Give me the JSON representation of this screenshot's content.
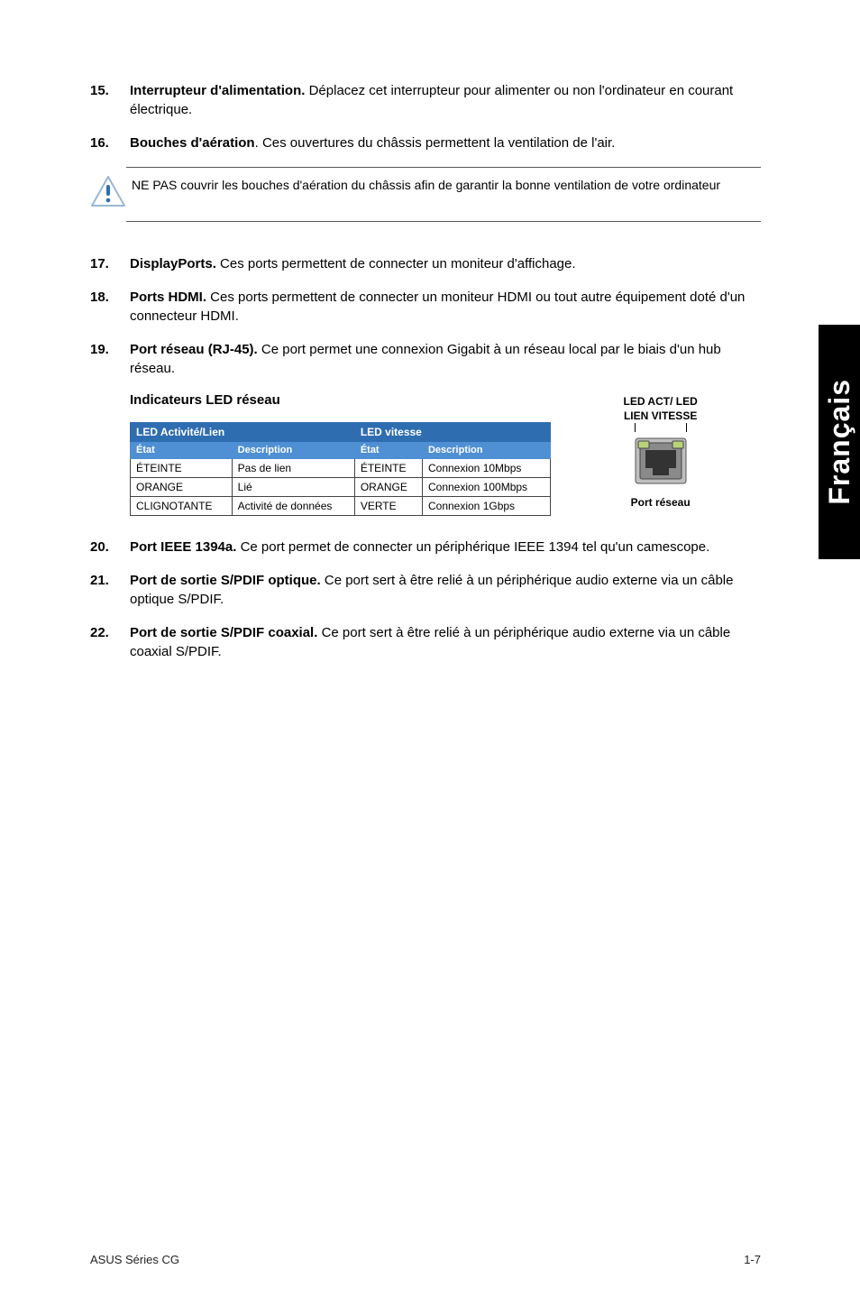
{
  "items": {
    "15": {
      "num": "15.",
      "title": "Interrupteur d'alimentation.",
      "text": " Déplacez cet interrupteur pour alimenter ou non l'ordinateur en courant électrique."
    },
    "16": {
      "num": "16.",
      "title": "Bouches d'aération",
      "text": ". Ces ouvertures du châssis permettent la ventilation de l'air."
    },
    "17": {
      "num": "17.",
      "title": "DisplayPorts.",
      "text": " Ces ports permettent de connecter un moniteur d'affichage."
    },
    "18": {
      "num": "18.",
      "title": "Ports HDMI.",
      "text": " Ces ports permettent de connecter un moniteur HDMI ou tout autre équipement doté d'un connecteur HDMI."
    },
    "19": {
      "num": "19.",
      "title": "Port réseau (RJ-45).",
      "text": " Ce port permet une connexion Gigabit à un réseau local par le biais d'un hub réseau."
    },
    "20": {
      "num": "20.",
      "title": "Port IEEE 1394a.",
      "text": " Ce port permet de connecter un périphérique IEEE 1394 tel qu'un camescope."
    },
    "21": {
      "num": "21.",
      "title": "Port de sortie S/PDIF optique.",
      "text": " Ce port sert à être relié à un périphérique audio externe via un câble optique S/PDIF."
    },
    "22": {
      "num": "22.",
      "title": "Port de sortie S/PDIF coaxial.",
      "text": " Ce port sert à être relié à un périphérique audio externe via un câble coaxial S/PDIF."
    }
  },
  "note": "NE PAS couvrir les bouches d'aération du châssis afin de garantir la bonne ventilation de votre ordinateur",
  "subhead": "Indicateurs LED réseau",
  "table": {
    "hdr_activity": "LED Activité/Lien",
    "hdr_speed": "LED vitesse",
    "col_state": "État",
    "col_desc": "Description",
    "rows": [
      {
        "s1": "ÉTEINTE",
        "d1": "Pas de lien",
        "s2": "ÉTEINTE",
        "d2": "Connexion 10Mbps"
      },
      {
        "s1": "ORANGE",
        "d1": "Lié",
        "s2": "ORANGE",
        "d2": "Connexion 100Mbps"
      },
      {
        "s1": "CLIGNOTANTE",
        "d1": "Activité de données",
        "s2": "VERTE",
        "d2": "Connexion 1Gbps"
      }
    ]
  },
  "port": {
    "line1": "LED ACT/   LED",
    "line2": "LIEN    VITESSE",
    "caption": "Port réseau"
  },
  "side_tab": "Français",
  "footer_left": "ASUS Séries CG",
  "footer_right": "1-7"
}
